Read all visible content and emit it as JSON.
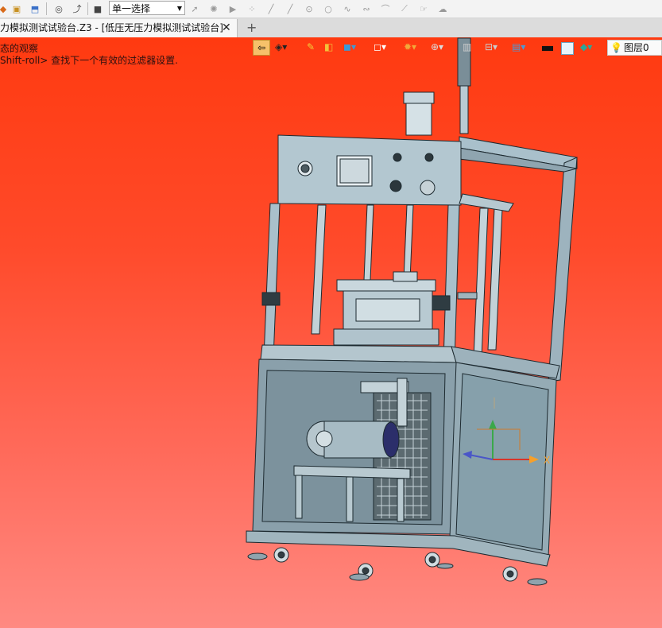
{
  "toolbar": {
    "select_mode": "单一选择",
    "icons": [
      "app-icon",
      "open-icon",
      "export-icon",
      "orbit-icon",
      "walk-icon",
      "stop-icon",
      "pointer-icon",
      "cursor-filter-icon",
      "play-icon",
      "point-icon",
      "line-icon",
      "line2-icon",
      "circle-icon",
      "circle2-icon",
      "curve-icon",
      "spline-icon",
      "arc-icon",
      "sketch-line-icon",
      "hand-icon",
      "cloud-icon"
    ]
  },
  "tabs": {
    "active_label": "力模拟测试试验台.Z3 - [低压无压力模拟测试试验台]",
    "close": "✕",
    "add": "+"
  },
  "hints": {
    "line1": "态的观察",
    "line2": "Shift-roll> 查找下一个有效的过滤器设置."
  },
  "view_toolbar": {
    "layer_label": "图层0",
    "accent": "#f6c16a"
  },
  "colors": {
    "viewport_top": "#ff3a10",
    "viewport_bottom": "#ff8a82",
    "machine": "#a9c0cb",
    "edge": "#1d2a30"
  }
}
